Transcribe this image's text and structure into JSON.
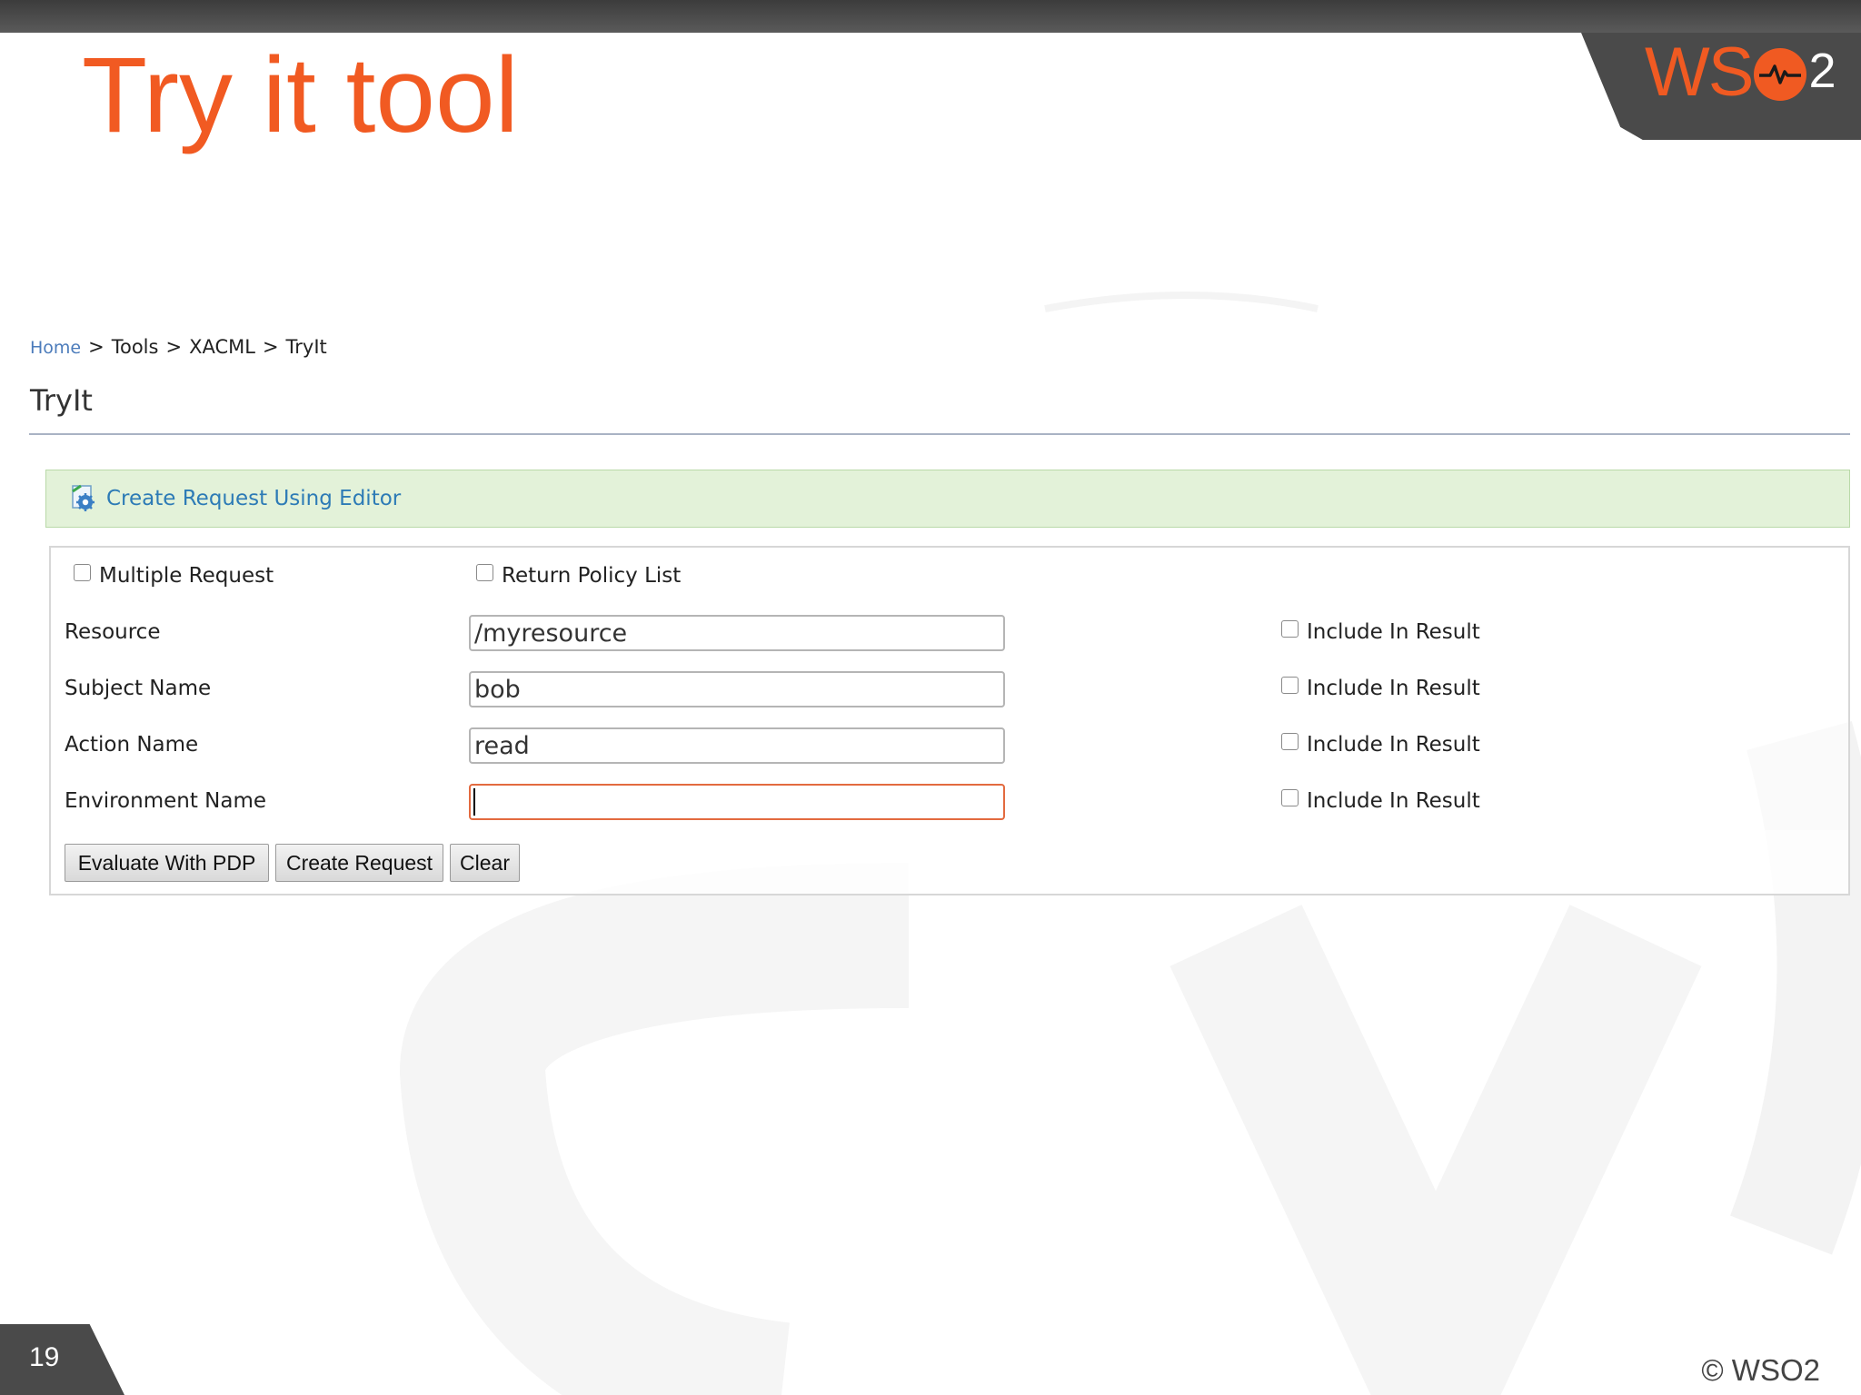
{
  "slide": {
    "title": "Try it tool",
    "number": "19",
    "copyright": "© WSO2"
  },
  "logo": {
    "text_ws": "WS",
    "subscript": "2",
    "brand_color": "#f05a22"
  },
  "breadcrumb": {
    "items": [
      "Home",
      "Tools",
      "XACML",
      "TryIt"
    ],
    "separator": ">"
  },
  "page": {
    "heading": "TryIt",
    "editor_link": "Create Request Using Editor"
  },
  "form": {
    "options": {
      "multiple_request": "Multiple Request",
      "return_policy_list": "Return Policy List"
    },
    "rows": [
      {
        "label": "Resource",
        "value": "/myresource",
        "include_label": "Include In Result"
      },
      {
        "label": "Subject Name",
        "value": "bob",
        "include_label": "Include In Result"
      },
      {
        "label": "Action Name",
        "value": "read",
        "include_label": "Include In Result"
      },
      {
        "label": "Environment Name",
        "value": "",
        "include_label": "Include In Result"
      }
    ],
    "buttons": {
      "evaluate": "Evaluate With PDP",
      "create": "Create Request",
      "clear": "Clear"
    }
  },
  "icons": {
    "editor": "gear-document-icon",
    "logo_o": "heartbeat-icon"
  }
}
